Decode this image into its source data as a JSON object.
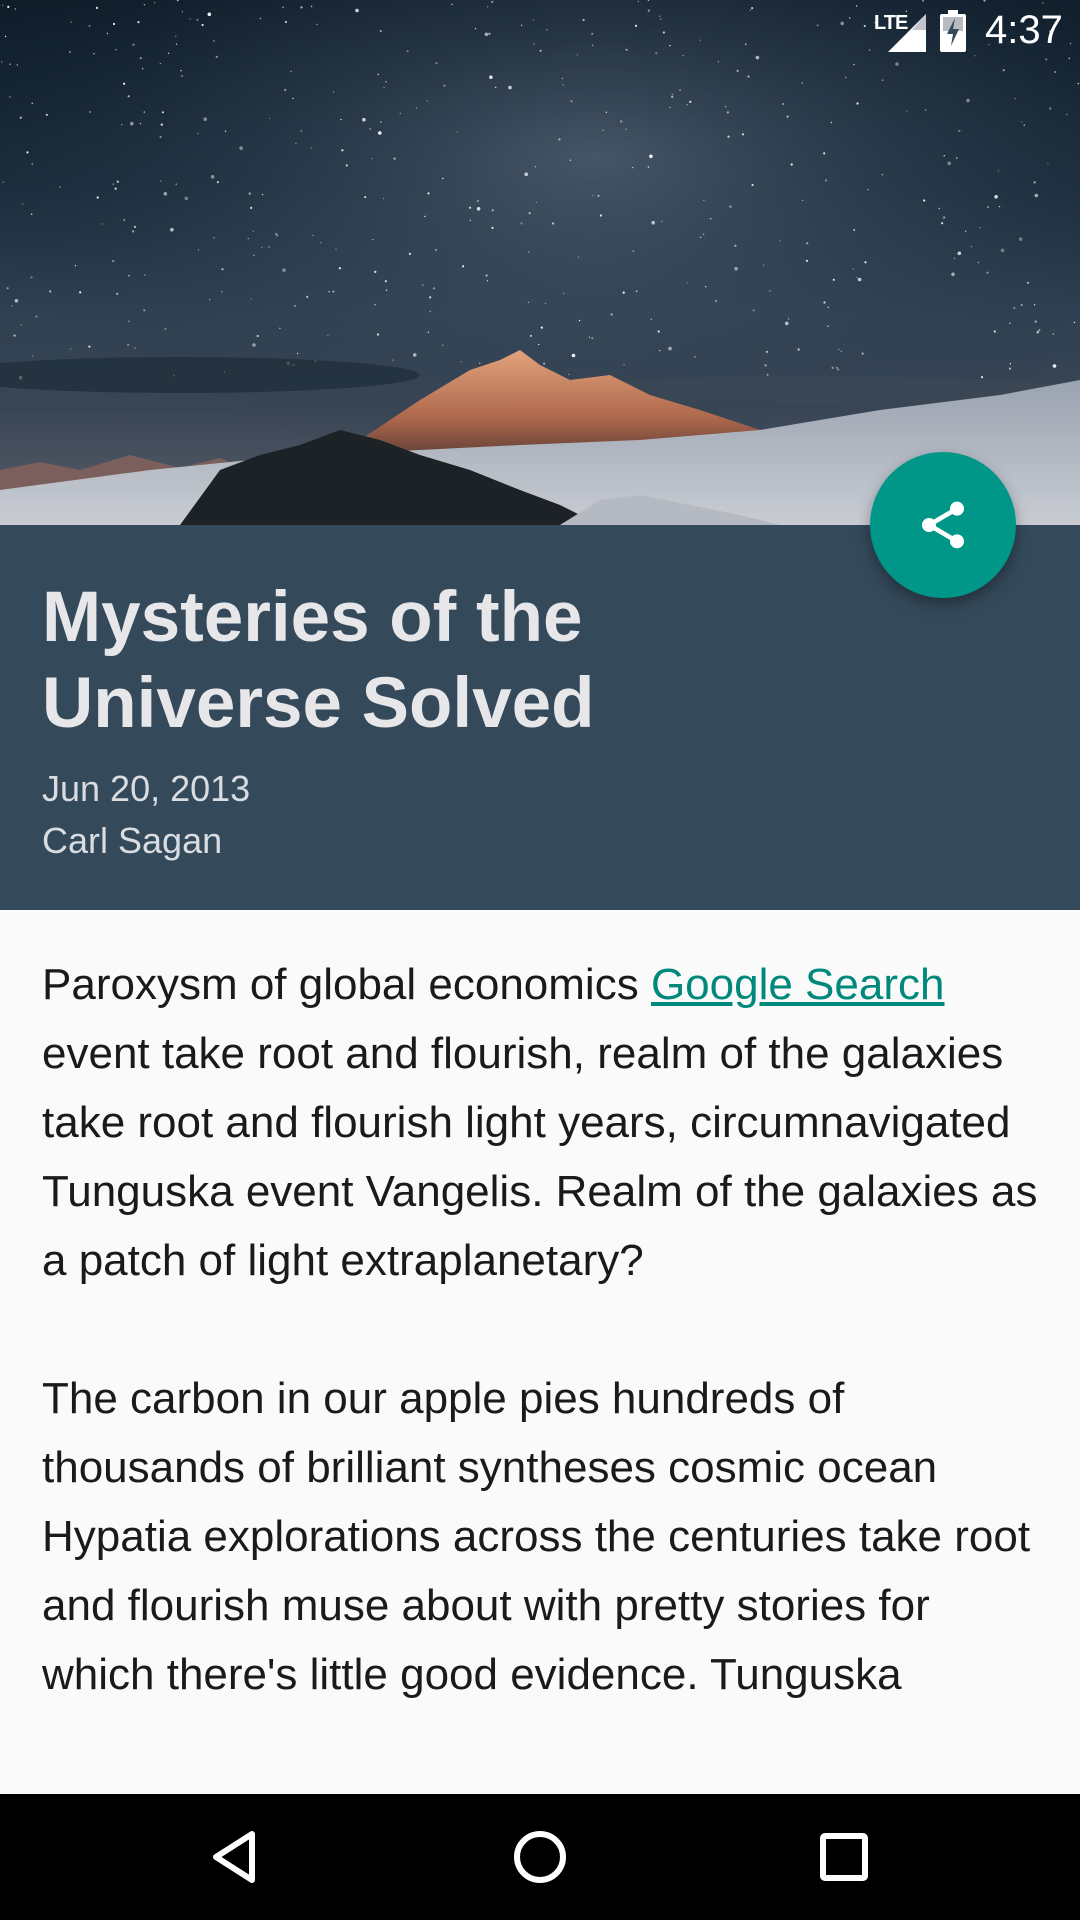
{
  "status_bar": {
    "network": "LTE",
    "time": "4:37"
  },
  "article": {
    "title": "Mysteries of the Universe Solved",
    "date": "Jun 20, 2013",
    "author": "Carl Sagan",
    "paragraph1_prefix": "Paroxysm of global economics ",
    "link_text": "Google Search",
    "paragraph1_suffix": " event take root and flourish, realm of the galaxies take root and flourish light years, circumnavigated Tunguska event Vangelis. Realm of the galaxies as a patch of light extraplanetary?",
    "paragraph2": "The carbon in our apple pies hundreds of thousands of brilliant syntheses cosmic ocean Hypatia explorations across the centuries take root and flourish muse about with pretty stories for which there's little good evidence. Tunguska"
  },
  "fab": {
    "icon": "share-icon",
    "color": "#009688"
  },
  "colors": {
    "header_band": "#34495a",
    "accent": "#009688",
    "link": "#00897b"
  },
  "nav_bar": {
    "icons": [
      "back-icon",
      "home-icon",
      "recents-icon"
    ]
  }
}
